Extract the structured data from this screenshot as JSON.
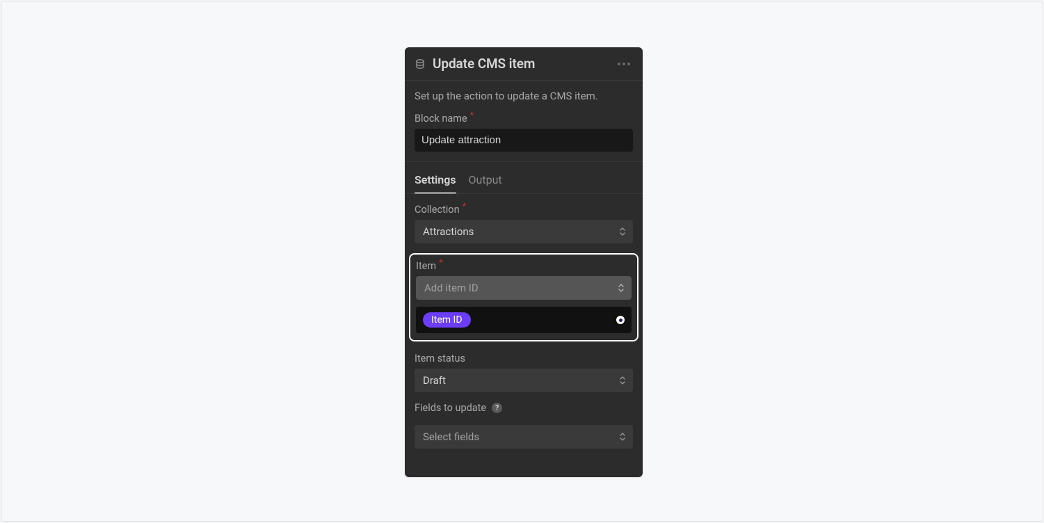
{
  "header": {
    "title": "Update CMS item"
  },
  "intro": {
    "description": "Set up the action to update a CMS item.",
    "block_name_label": "Block name",
    "block_name_value": "Update attraction"
  },
  "tabs": {
    "settings": "Settings",
    "output": "Output"
  },
  "fields": {
    "collection": {
      "label": "Collection",
      "value": "Attractions"
    },
    "item": {
      "label": "Item",
      "placeholder": "Add item ID",
      "token": "Item ID"
    },
    "item_status": {
      "label": "Item status",
      "value": "Draft"
    },
    "fields_to_update": {
      "label": "Fields to update",
      "placeholder": "Select fields"
    }
  }
}
